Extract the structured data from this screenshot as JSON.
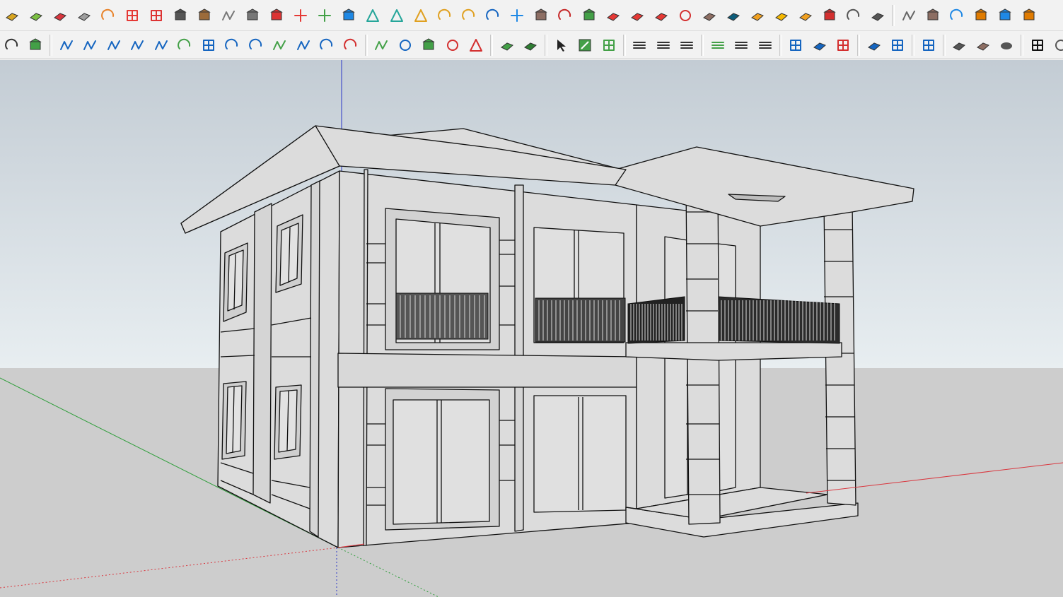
{
  "toolbar_top": [
    {
      "name": "paint-face-icon",
      "color": "#d8a520"
    },
    {
      "name": "push-face-icon",
      "color": "#7cc043"
    },
    {
      "name": "red-face-icon",
      "color": "#d9363e"
    },
    {
      "name": "grid-face-icon",
      "color": "#9e9e9e"
    },
    {
      "name": "follow-me-icon",
      "color": "#e8832a"
    },
    {
      "name": "section-plane-icon",
      "color": "#e53935"
    },
    {
      "name": "table-icon",
      "color": "#d33"
    },
    {
      "name": "flag-icon",
      "color": "#555555"
    },
    {
      "name": "box-component-icon",
      "color": "#9c6b3a"
    },
    {
      "name": "tape-icon",
      "color": "#777777"
    },
    {
      "name": "offset-icon",
      "color": "#777777"
    },
    {
      "name": "curve-points-icon",
      "color": "#d33"
    },
    {
      "name": "move-cross-red-icon",
      "color": "#e53935"
    },
    {
      "name": "move-cross-green-icon",
      "color": "#43a047"
    },
    {
      "name": "scatter-blue-icon",
      "color": "#1e88e5"
    },
    {
      "name": "cone-icon",
      "color": "#26a69a"
    },
    {
      "name": "drop-icon",
      "color": "#26a69a"
    },
    {
      "name": "pyramid-icon",
      "color": "#e0a020"
    },
    {
      "name": "spiral-icon",
      "color": "#e0a020"
    },
    {
      "name": "bend-icon",
      "color": "#e0a020"
    },
    {
      "name": "twist-icon",
      "color": "#1565c0"
    },
    {
      "name": "axes-icon",
      "color": "#1e88e5"
    },
    {
      "name": "extrude-icon",
      "color": "#8d6e63"
    },
    {
      "name": "undo-loop-icon",
      "color": "#c62828"
    },
    {
      "name": "shape-green-icon",
      "color": "#43a047"
    },
    {
      "name": "rotate-faces-icon",
      "color": "#e53935"
    },
    {
      "name": "scale-faces-icon",
      "color": "#e53935"
    },
    {
      "name": "split-faces-icon",
      "color": "#e53935"
    },
    {
      "name": "red-dot-icon",
      "color": "#d32f2f"
    },
    {
      "name": "cube-grid-icon",
      "color": "#8d6e63"
    },
    {
      "name": "frame-icon",
      "color": "#0d5c7a"
    },
    {
      "name": "orange-grid-icon",
      "color": "#f0a020"
    },
    {
      "name": "yellow-grid-icon",
      "color": "#f5b800"
    },
    {
      "name": "orange-grid2-icon",
      "color": "#f0a020"
    },
    {
      "name": "explode-icon",
      "color": "#d32f2f"
    },
    {
      "name": "arc-dots-icon",
      "color": "#555555"
    },
    {
      "name": "components-grid-icon",
      "color": "#555555"
    },
    {
      "name": "sep"
    },
    {
      "name": "pencil-icon",
      "color": "#666666"
    },
    {
      "name": "dimension-icon",
      "color": "#8d6e63"
    },
    {
      "name": "orbit-arrow-icon",
      "color": "#1e88e5"
    },
    {
      "name": "paint-bucket-icon",
      "color": "#e07b00"
    },
    {
      "name": "house-blue-icon",
      "color": "#1e88e5"
    },
    {
      "name": "pen-box-icon",
      "color": "#e07b00"
    }
  ],
  "toolbar_bottom": [
    {
      "name": "edge-arc-icon",
      "color": "#333333"
    },
    {
      "name": "leaf-shape-icon",
      "color": "#43a047"
    },
    {
      "name": "sep"
    },
    {
      "name": "bezier-icon",
      "color": "#1565c0"
    },
    {
      "name": "polyline-icon",
      "color": "#1565c0"
    },
    {
      "name": "freehand-icon",
      "color": "#1565c0"
    },
    {
      "name": "spline-icon",
      "color": "#1565c0"
    },
    {
      "name": "bridge-icon",
      "color": "#1565c0"
    },
    {
      "name": "arc-green-icon",
      "color": "#43a047"
    },
    {
      "name": "rectangle-icon",
      "color": "#1565c0"
    },
    {
      "name": "spiral-circle-icon",
      "color": "#1565c0"
    },
    {
      "name": "arc-blue-icon",
      "color": "#1565c0"
    },
    {
      "name": "zigzag-green-icon",
      "color": "#43a047"
    },
    {
      "name": "hook-icon",
      "color": "#1565c0"
    },
    {
      "name": "curl-icon",
      "color": "#1565c0"
    },
    {
      "name": "arc-red-icon",
      "color": "#d32f2f"
    },
    {
      "name": "sep"
    },
    {
      "name": "line-green-icon",
      "color": "#43a047"
    },
    {
      "name": "polygon-icon",
      "color": "#1565c0"
    },
    {
      "name": "wrench-icon",
      "color": "#43a047"
    },
    {
      "name": "ellipse-red-icon",
      "color": "#d32f2f"
    },
    {
      "name": "triangle-red-icon",
      "color": "#d32f2f"
    },
    {
      "name": "sep"
    },
    {
      "name": "surface-green-icon",
      "color": "#43a047"
    },
    {
      "name": "surface-dark-icon",
      "color": "#2e7d32"
    },
    {
      "name": "sep"
    },
    {
      "name": "select-cursor-icon",
      "color": "#1565c0"
    },
    {
      "name": "zoom-extents-icon",
      "color": "#43a047"
    },
    {
      "name": "zoom-window-icon",
      "color": "#43a047"
    },
    {
      "name": "sep"
    },
    {
      "name": "align-lines-icon",
      "color": "#333333"
    },
    {
      "name": "align-plus-icon",
      "color": "#333333"
    },
    {
      "name": "align-minus-icon",
      "color": "#333333"
    },
    {
      "name": "sep"
    },
    {
      "name": "dash-green-icon",
      "color": "#43a047"
    },
    {
      "name": "dash-plus-icon",
      "color": "#333333"
    },
    {
      "name": "dash-minus-icon",
      "color": "#333333"
    },
    {
      "name": "sep"
    },
    {
      "name": "section-x-icon",
      "color": "#1565c0"
    },
    {
      "name": "section-grid-icon",
      "color": "#1565c0"
    },
    {
      "name": "section-red-icon",
      "color": "#d32f2f"
    },
    {
      "name": "sep"
    },
    {
      "name": "window-grid-icon",
      "color": "#1565c0"
    },
    {
      "name": "window-split-icon",
      "color": "#1565c0"
    },
    {
      "name": "sep"
    },
    {
      "name": "window-diag-icon",
      "color": "#1565c0"
    },
    {
      "name": "sep"
    },
    {
      "name": "tiles-icon",
      "color": "#555555"
    },
    {
      "name": "tiles-brown-icon",
      "color": "#8d6e63"
    },
    {
      "name": "cloud-icon",
      "color": "#555555"
    },
    {
      "name": "sep"
    },
    {
      "name": "checker-icon",
      "color": "#111111"
    },
    {
      "name": "dotted-icon",
      "color": "#555555"
    }
  ],
  "viewport": {
    "sky_top": "#c3ccd4",
    "sky_bottom": "#e8eef1",
    "ground": "#cdcdcd",
    "wall": "#dcdcdc",
    "line": "#111111",
    "axis_red": "#d9363e",
    "axis_green": "#2e9e3a",
    "axis_blue": "#2a36c8"
  }
}
